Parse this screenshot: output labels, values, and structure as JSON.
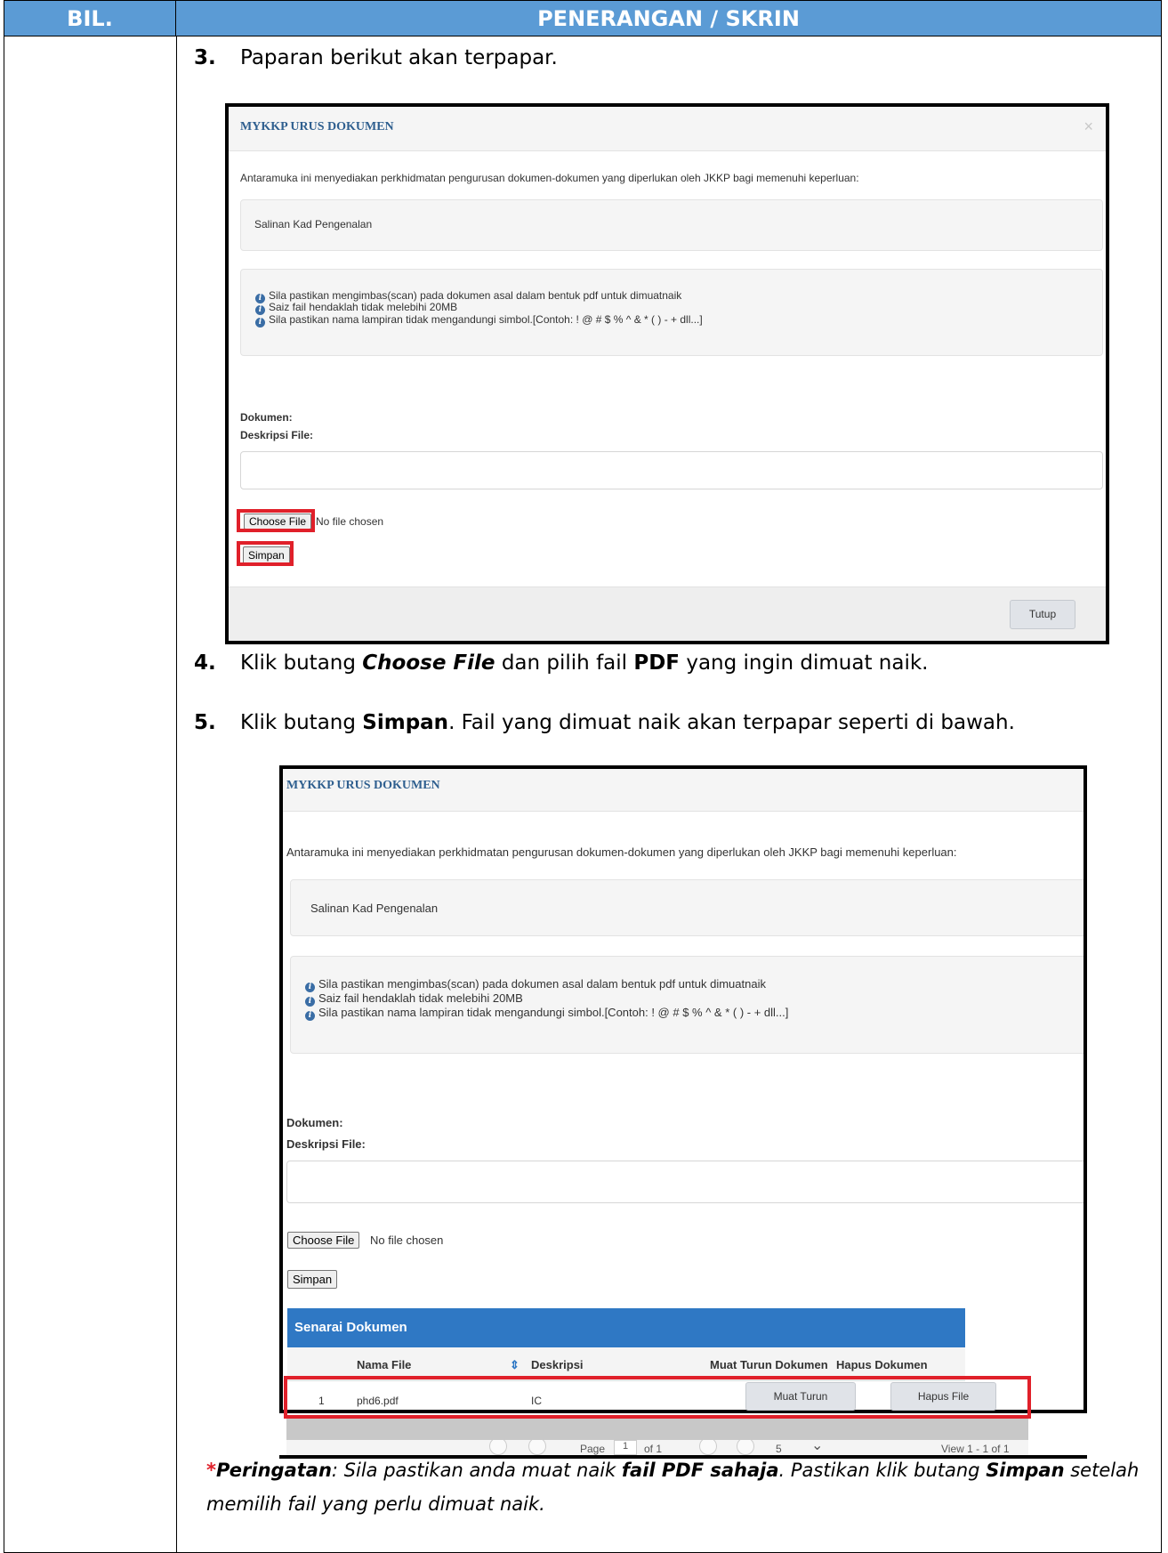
{
  "header": {
    "col1": "BIL.",
    "col2": "PENERANGAN / SKRIN"
  },
  "steps": [
    {
      "num": "3.",
      "text": "Paparan berikut akan terpapar."
    },
    {
      "num": "4.",
      "pre": "Klik butang ",
      "bold1": "Choose File",
      "mid": " dan pilih fail ",
      "bold2": "PDF",
      "post": " yang ingin dimuat naik."
    },
    {
      "num": "5.",
      "pre": "Klik butang ",
      "bold1": "Simpan",
      "post": ". Fail yang dimuat naik akan terpapar seperti di bawah."
    }
  ],
  "modal": {
    "title": "MYKKP URUS DOKUMEN",
    "close": "×",
    "intro": "Antaramuka ini menyediakan perkhidmatan pengurusan dokumen-dokumen yang diperlukan oleh JKKP bagi memenuhi keperluan:",
    "doc_type": "Salinan Kad Pengenalan",
    "info_icon": "i",
    "info": [
      "Sila pastikan mengimbas(scan) pada dokumen asal dalam bentuk pdf untuk dimuatnaik",
      "Saiz fail hendaklah tidak melebihi 20MB",
      "Sila pastikan nama lampiran tidak mengandungi simbol.[Contoh: ! @ # $ % ^ & * ( ) - + dll...]"
    ],
    "label_dokumen": "Dokumen:",
    "label_deskripsi": "Deskripsi File:",
    "choose_file": "Choose File",
    "no_file": "No file chosen",
    "simpan": "Simpan",
    "tutup": "Tutup"
  },
  "grid": {
    "title": "Senarai Dokumen",
    "columns": [
      "Nama File",
      "Deskripsi",
      "Muat Turun Dokumen",
      "Hapus Dokumen"
    ],
    "sort_icon": "⇕",
    "rows": [
      {
        "no": "1",
        "nama": "phd6.pdf",
        "deskripsi": "IC",
        "muat_turun": "Muat Turun",
        "hapus": "Hapus File"
      }
    ],
    "pager": {
      "page_label": "Page",
      "page": "1",
      "of": "of 1",
      "rows": "5",
      "dropdown_icon": "⌄",
      "view": "View 1 - 1 of 1"
    }
  },
  "note": {
    "star": "*",
    "label": "Peringatan",
    "t1": ": Sila pastikan anda muat naik ",
    "b1": "fail PDF sahaja",
    "t2": ". Pastikan klik butang ",
    "b2": "Simpan",
    "t3": " setelah memilih fail yang perlu dimuat naik."
  },
  "colors": {
    "header_bg": "#5b9bd5",
    "highlight": "#e0202a",
    "grid_header": "#2f78c4",
    "modal_title": "#2f5f8f"
  }
}
